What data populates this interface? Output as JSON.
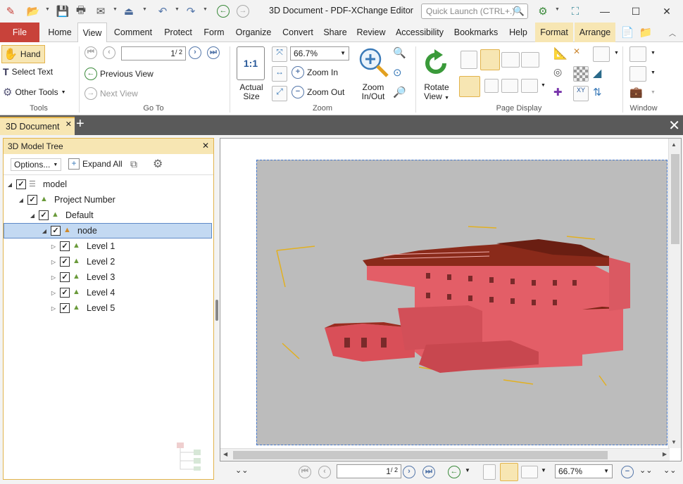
{
  "window": {
    "title": "3D Document - PDF-XChange Editor",
    "quick_launch_placeholder": "Quick Launch (CTRL+.)"
  },
  "menu_tabs": [
    "File",
    "Home",
    "View",
    "Comment",
    "Protect",
    "Form",
    "Organize",
    "Convert",
    "Share",
    "Review",
    "Accessibility",
    "Bookmarks",
    "Help",
    "Format",
    "Arrange"
  ],
  "ribbon": {
    "tools": {
      "hand": "Hand",
      "select_text": "Select Text",
      "other_tools": "Other Tools",
      "label": "Tools"
    },
    "goto": {
      "page_value": "1",
      "page_total": "/ 2",
      "previous_view": "Previous View",
      "next_view": "Next View",
      "label": "Go To"
    },
    "zoom": {
      "actual_size_line1": "Actual",
      "actual_size_line2": "Size",
      "actual_size_icon": "1:1",
      "zoom_value": "66.7%",
      "zoom_in": "Zoom In",
      "zoom_out": "Zoom Out",
      "zoom_inout_line1": "Zoom",
      "zoom_inout_line2": "In/Out",
      "label": "Zoom"
    },
    "page_display": {
      "rotate_line1": "Rotate",
      "rotate_line2": "View",
      "label": "Page Display"
    },
    "window": {
      "label": "Window"
    }
  },
  "doc_tab": {
    "title": "3D Document"
  },
  "panel": {
    "title": "3D Model Tree",
    "options": "Options...",
    "expand_all": "Expand All",
    "tree": [
      {
        "label": "model",
        "level": 0,
        "checked": true,
        "selected": false
      },
      {
        "label": "Project Number",
        "level": 1,
        "checked": true,
        "selected": false
      },
      {
        "label": "Default",
        "level": 2,
        "checked": true,
        "selected": false
      },
      {
        "label": "node",
        "level": 3,
        "checked": true,
        "selected": true
      },
      {
        "label": "Level 1",
        "level": 4,
        "checked": true,
        "selected": false
      },
      {
        "label": "Level 2",
        "level": 4,
        "checked": true,
        "selected": false
      },
      {
        "label": "Level 3",
        "level": 4,
        "checked": true,
        "selected": false
      },
      {
        "label": "Level 4",
        "level": 4,
        "checked": true,
        "selected": false
      },
      {
        "label": "Level 5",
        "level": 4,
        "checked": true,
        "selected": false
      }
    ]
  },
  "status": {
    "page_value": "1",
    "page_total": "/ 2",
    "zoom_value": "66.7%"
  },
  "colors": {
    "file_tab": "#c8423a",
    "accent": "#e2b34c",
    "model_red": "#e05a62",
    "model_roof": "#8a2a1a"
  }
}
